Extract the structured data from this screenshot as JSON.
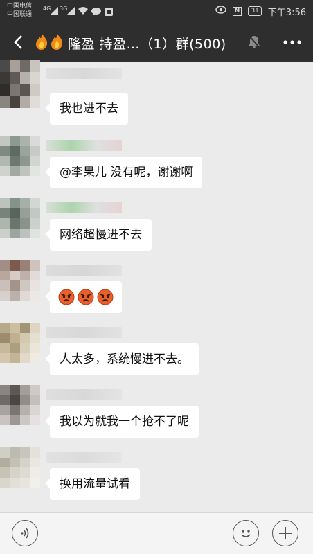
{
  "status_bar": {
    "carrier_1": "中国电信",
    "carrier_2": "中国联通",
    "signal_1": "4G",
    "signal_2": "3G",
    "battery": "31",
    "time": "下午3:56"
  },
  "header": {
    "title": "隆盈 持盈…（1）群(500)"
  },
  "messages": [
    {
      "text": "我也进不去"
    },
    {
      "text": "@李果儿  没有呢，谢谢啊"
    },
    {
      "text": "网络超慢进不去"
    },
    {
      "emoji": [
        "angry-face",
        "angry-face",
        "angry-face"
      ]
    },
    {
      "text": "人太多，系统慢进不去。"
    },
    {
      "text": "我以为就我一个抢不了呢"
    },
    {
      "text": "换用流量试看"
    }
  ],
  "colors": {
    "header_bg": "#2e2e2e",
    "chat_bg": "#ebebeb",
    "bubble_bg": "#ffffff",
    "input_bar_bg": "#f4f4f4"
  }
}
